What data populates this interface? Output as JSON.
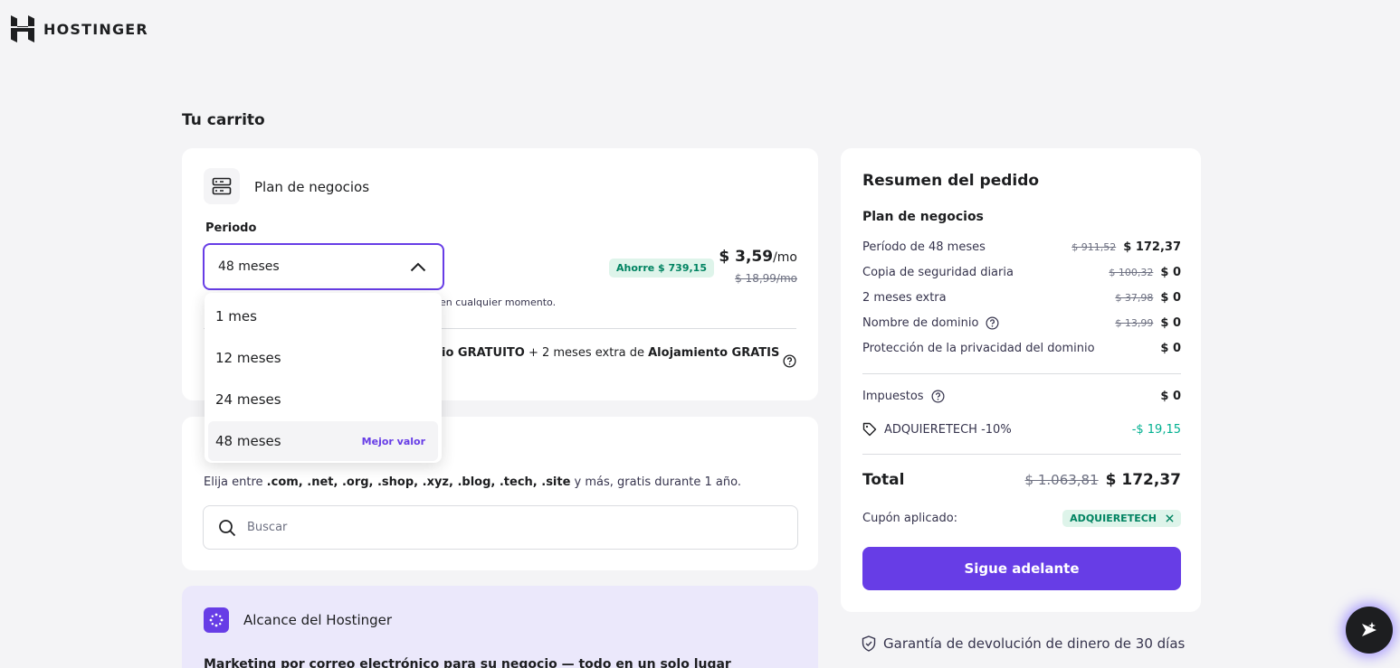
{
  "brand": {
    "name": "HOSTINGER"
  },
  "page": {
    "title": "Tu carrito"
  },
  "plan": {
    "title": "Plan de negocios",
    "period_label": "Periodo",
    "selected_period": "48 meses",
    "savings_badge": "Ahorre $ 739,15",
    "price": "$ 3,59",
    "price_unit": "/mo",
    "price_old": "$ 18,99/mo",
    "cancel_note_fragment": "en cualquier momento.",
    "promo": {
      "part1": "io GRATUITO",
      "part2": " + 2 meses extra de ",
      "part3": "Alojamiento GRATIS"
    }
  },
  "dropdown": {
    "options": [
      {
        "label": "1 mes",
        "badge": ""
      },
      {
        "label": "12 meses",
        "badge": ""
      },
      {
        "label": "24 meses",
        "badge": ""
      },
      {
        "label": "48 meses",
        "badge": "Mejor valor"
      }
    ]
  },
  "domain": {
    "text_prefix": "Elija entre ",
    "tlds": ".com, .net, .org, .shop, .xyz, .blog, .tech, .site",
    "text_suffix": " y más, gratis durante 1 año.",
    "search_placeholder": "Buscar"
  },
  "reach": {
    "title": "Alcance del Hostinger",
    "subtitle": "Marketing por correo electrónico para su negocio — todo en un solo lugar"
  },
  "summary": {
    "title": "Resumen del pedido",
    "plan_name": "Plan de negocios",
    "items": [
      {
        "label": "Período de 48 meses",
        "old": "$ 911,52",
        "new": "$ 172,37"
      },
      {
        "label": "Copia de seguridad diaria",
        "old": "$ 100,32",
        "new": "$ 0"
      },
      {
        "label": "2 meses extra",
        "old": "$ 37,98",
        "new": "$ 0"
      },
      {
        "label": "Nombre de dominio",
        "old": "$ 13,99",
        "new": "$ 0"
      },
      {
        "label": "Protección de la privacidad del dominio",
        "old": "",
        "new": "$ 0"
      }
    ],
    "tax_label": "Impuestos",
    "tax_value": "$ 0",
    "coupon_code_label": "ADQUIERETECH -10%",
    "coupon_discount": "-$ 19,15",
    "total_label": "Total",
    "total_old": "$ 1.063,81",
    "total_new": "$ 172,37",
    "coupon_applied_label": "Cupón aplicado:",
    "coupon_badge": "ADQUIERETECH",
    "cta_label": "Sigue adelante"
  },
  "guarantee": {
    "text": "Garantía de devolución de dinero de 30 días"
  },
  "colors": {
    "primary": "#673de6",
    "success": "#008361",
    "success_bg": "#def4ea",
    "discount": "#00b090",
    "text": "#1d1e20"
  }
}
